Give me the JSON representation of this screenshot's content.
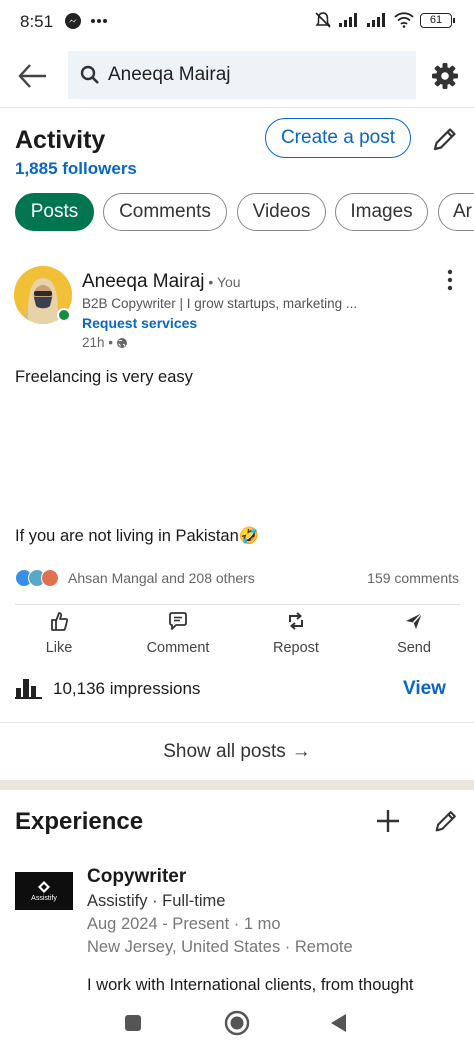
{
  "status_bar": {
    "time": "8:51",
    "battery": "61"
  },
  "search": {
    "query": "Aneeqa Mairaj"
  },
  "activity": {
    "title": "Activity",
    "followers": "1,885 followers",
    "create_post": "Create a post",
    "filters": [
      "Posts",
      "Comments",
      "Videos",
      "Images",
      "Ar"
    ]
  },
  "post": {
    "author": "Aneeqa Mairaj",
    "author_suffix": " • You",
    "headline": "B2B Copywriter | I grow startups, marketing ...",
    "request_services": "Request services",
    "time": "21h •",
    "text1": "Freelancing is very easy",
    "text2": "If you are not living in Pakistan🤣",
    "reactors": "Ahsan Mangal and 208 others",
    "comments": "159 comments",
    "actions": {
      "like": "Like",
      "comment": "Comment",
      "repost": "Repost",
      "send": "Send"
    },
    "impressions": "10,136 impressions",
    "view": "View"
  },
  "show_all": {
    "label": "Show all posts",
    "arrow": "→"
  },
  "experience": {
    "title": "Experience",
    "job_title": "Copywriter",
    "company": "Assistify · Full-time",
    "dates": "Aug 2024 - Present · 1 mo",
    "location": "New Jersey, United States · Remote",
    "description": "I work with International clients, from thought",
    "logo_text": "Assistify"
  },
  "colors": {
    "brand_blue": "#0a66c2",
    "active_chip": "#01754f",
    "online": "#1a8a43",
    "avatar_bg": "#f2c037"
  }
}
